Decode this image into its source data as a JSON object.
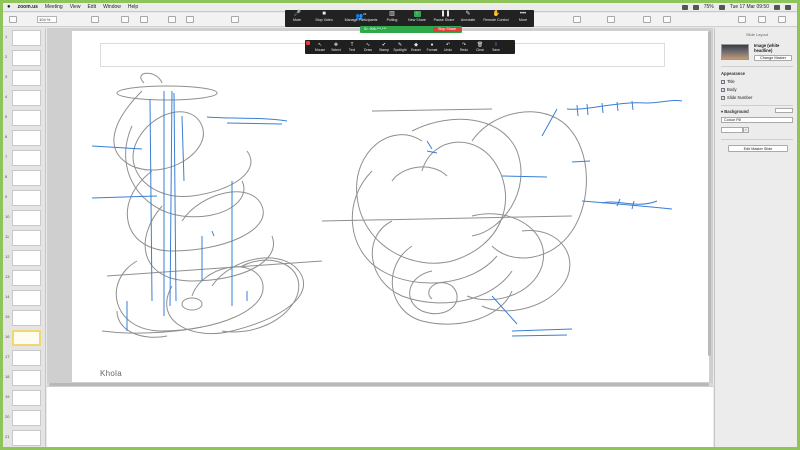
{
  "menubar": {
    "app_name": "zoom.us",
    "items": [
      "Meeting",
      "View",
      "Edit",
      "Window",
      "Help"
    ],
    "clock": "Tue 17 Mar  09:50",
    "battery": "75%"
  },
  "toolbar": {
    "zoom_level": "104 %"
  },
  "navigator": {
    "slide_numbers": [
      "1",
      "2",
      "3",
      "4",
      "5",
      "6",
      "7",
      "8",
      "9",
      "10",
      "11",
      "12",
      "13",
      "14",
      "15",
      "16",
      "17",
      "18",
      "19",
      "20",
      "21"
    ],
    "selected_index": 15
  },
  "slide": {
    "caption": "Khola"
  },
  "zoom_controls": {
    "mute": "Mute",
    "stop_video": "Stop Video",
    "manage_participants": "Manage Participants",
    "participant_count": "24",
    "polling": "Polling",
    "new_share": "New Share",
    "pause_share": "Pause Share",
    "annotate": "Annotate",
    "remote_control": "Remote Control",
    "more": "More"
  },
  "share_banner": {
    "meeting_id": "ID: 908-***-***",
    "stop_share": "Stop Share"
  },
  "annotation_tools": [
    {
      "label": "Mouse",
      "icon": "↖"
    },
    {
      "label": "Select",
      "icon": "✥"
    },
    {
      "label": "Text",
      "icon": "T"
    },
    {
      "label": "Draw",
      "icon": "∿"
    },
    {
      "label": "Stamp",
      "icon": "✔"
    },
    {
      "label": "Spotlight",
      "icon": "✎"
    },
    {
      "label": "Eraser",
      "icon": "◆"
    },
    {
      "label": "Format",
      "icon": "●"
    },
    {
      "label": "Undo",
      "icon": "↶"
    },
    {
      "label": "Redo",
      "icon": "↷"
    },
    {
      "label": "Clear",
      "icon": "🗑"
    },
    {
      "label": "Save",
      "icon": "⇪"
    }
  ],
  "inspector": {
    "section_title": "Slide Layout",
    "master_name": "Image (white headline)",
    "change_master": "Change Master",
    "appearance_label": "Appearance",
    "checks": [
      "Title",
      "Body",
      "Slide Number"
    ],
    "background_label": "Background",
    "fill_type": "Colour Fill",
    "edit_master": "Edit Master Slide"
  },
  "colors": {
    "sketch_stroke": "#8f8f8f",
    "annotation_blue": "#3a7fd6",
    "zoom_green": "#2fa84a",
    "stop_red": "#e23d3d",
    "screen_frame": "#8fc45a"
  }
}
